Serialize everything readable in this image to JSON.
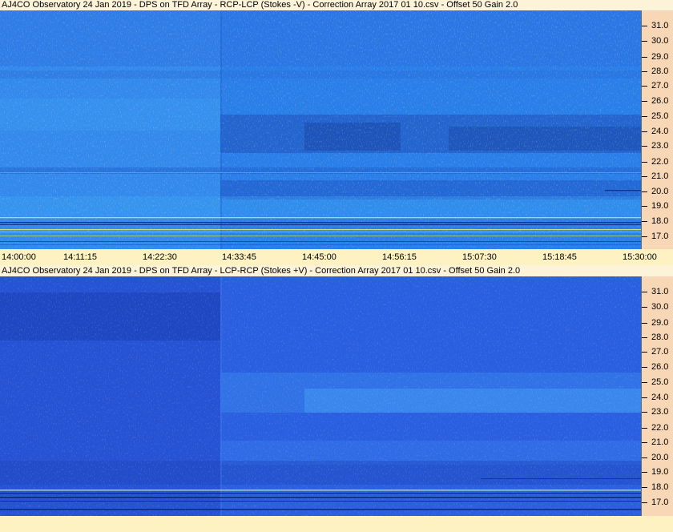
{
  "panels": [
    {
      "title": "AJ4CO Observatory 24 Jan 2019  -  DPS on TFD Array  -  RCP-LCP (Stokes -V)  -  Correction Array 2017 01 10.csv  -  Offset 50  Gain 2.0",
      "y_ticks": [
        "31.0",
        "30.0",
        "29.0",
        "28.0",
        "27.0",
        "26.0",
        "25.0",
        "24.0",
        "23.0",
        "22.0",
        "21.0",
        "20.0",
        "19.0",
        "18.0",
        "17.0"
      ],
      "x_ticks": [
        "14:00:00",
        "14:11:15",
        "14:22:30",
        "14:33:45",
        "14:45:00",
        "14:56:15",
        "15:07:30",
        "15:18:45",
        "15:30:00"
      ],
      "colors": {
        "base": "#2a7ee8",
        "light": "#3aa3f2",
        "dark": "#1f57c9"
      }
    },
    {
      "title": "AJ4CO Observatory 24 Jan 2019  -  DPS on TFD Array  -  LCP-RCP (Stokes +V)  -  Correction Array 2017 01 10.csv  -  Offset 50  Gain 2.0",
      "y_ticks": [
        "31.0",
        "30.0",
        "29.0",
        "28.0",
        "27.0",
        "26.0",
        "25.0",
        "24.0",
        "23.0",
        "22.0",
        "21.0",
        "20.0",
        "19.0",
        "18.0",
        "17.0"
      ],
      "x_ticks": [],
      "colors": {
        "base": "#2a5fe0",
        "light": "#3f8ff0",
        "dark": "#1c3fb8"
      }
    }
  ],
  "axis_bg_color": "#f8d7b6",
  "time_axis_bg_color": "#fff2c2"
}
